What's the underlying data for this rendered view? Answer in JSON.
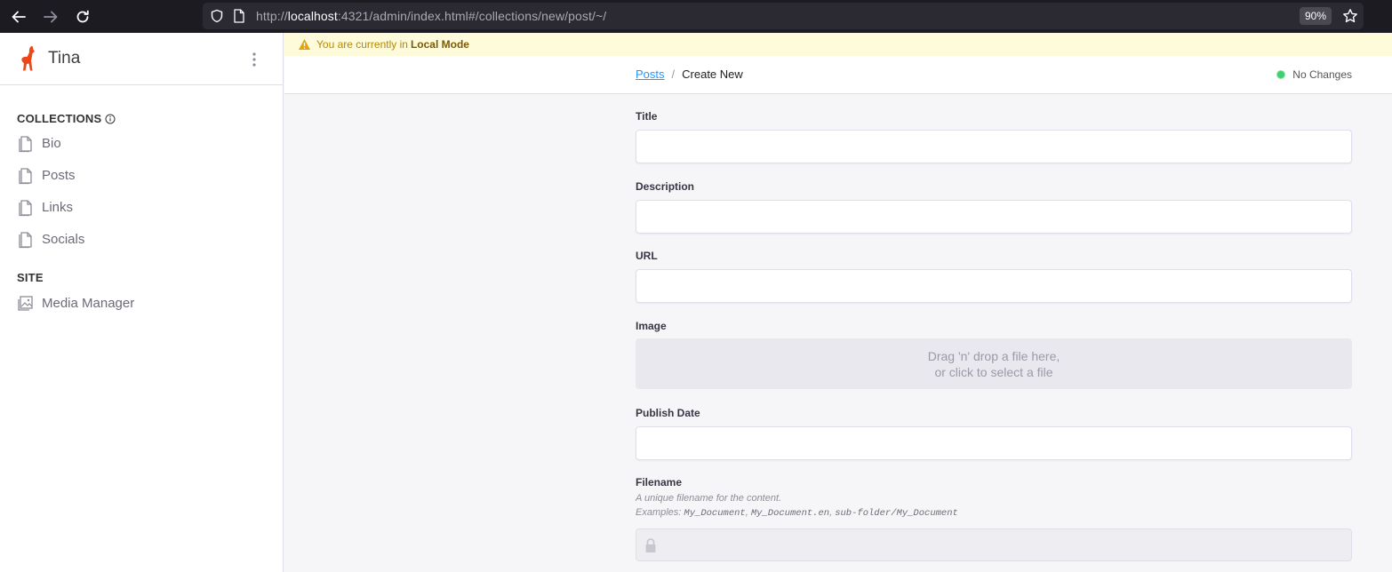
{
  "browser": {
    "url_scheme": "http://",
    "url_host": "localhost",
    "url_path": ":4321/admin/index.html#/collections/new/post/~/",
    "zoom": "90%"
  },
  "sidebar": {
    "brand": "Tina",
    "collections_title": "COLLECTIONS",
    "collections": [
      {
        "label": "Bio",
        "icon": "document-icon"
      },
      {
        "label": "Posts",
        "icon": "document-icon"
      },
      {
        "label": "Links",
        "icon": "document-icon"
      },
      {
        "label": "Socials",
        "icon": "document-icon"
      }
    ],
    "site_title": "SITE",
    "site_items": [
      {
        "label": "Media Manager",
        "icon": "image-icon"
      }
    ]
  },
  "banner": {
    "text": "You are currently in",
    "mode": "Local Mode"
  },
  "breadcrumb": {
    "parent": "Posts",
    "separator": "/",
    "current": "Create New"
  },
  "status": {
    "label": "No Changes",
    "color": "#3fcf74"
  },
  "form": {
    "title_label": "Title",
    "description_label": "Description",
    "url_label": "URL",
    "image_label": "Image",
    "image_drop_line1": "Drag 'n' drop a file here,",
    "image_drop_line2": "or click to select a file",
    "publish_date_label": "Publish Date",
    "filename_label": "Filename",
    "filename_help": "A unique filename for the content.",
    "filename_examples_prefix": "Examples:",
    "filename_examples": [
      "My_Document",
      "My_Document.en",
      "sub-folder/My_Document"
    ]
  },
  "colors": {
    "accent": "#2296fe",
    "brand": "#ec4815",
    "banner_bg": "#fefbdb"
  }
}
